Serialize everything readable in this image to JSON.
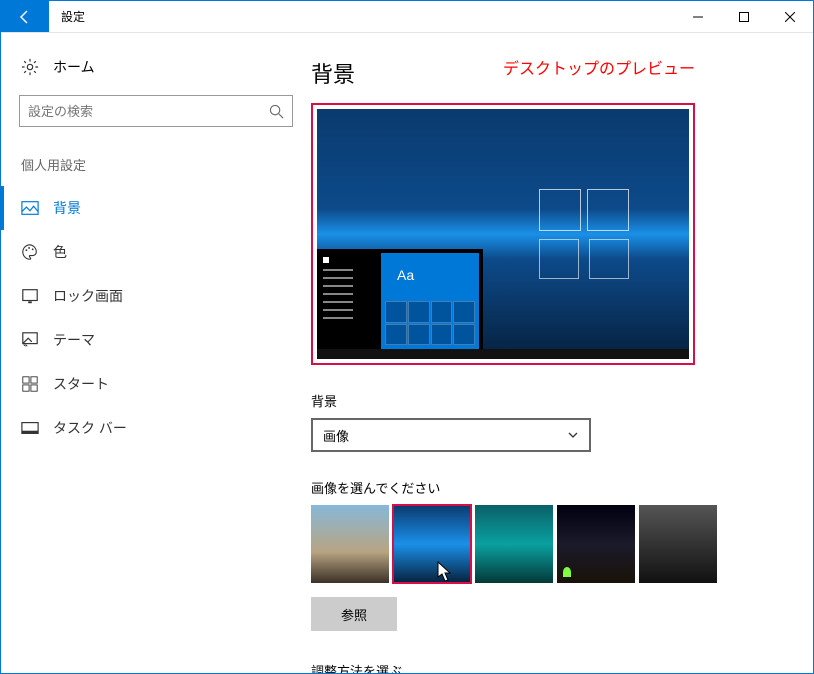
{
  "titlebar": {
    "title": "設定"
  },
  "sidebar": {
    "home": "ホーム",
    "search_placeholder": "設定の検索",
    "section": "個人用設定",
    "items": [
      {
        "label": "背景"
      },
      {
        "label": "色"
      },
      {
        "label": "ロック画面"
      },
      {
        "label": "テーマ"
      },
      {
        "label": "スタート"
      },
      {
        "label": "タスク バー"
      }
    ]
  },
  "main": {
    "title": "背景",
    "annotation_preview": "デスクトップのプレビュー",
    "preview_aa": "Aa",
    "bg_label": "背景",
    "bg_value": "画像",
    "choose_label": "画像を選んでください",
    "browse": "参照",
    "fit_label": "調整方法を選ぶ"
  }
}
